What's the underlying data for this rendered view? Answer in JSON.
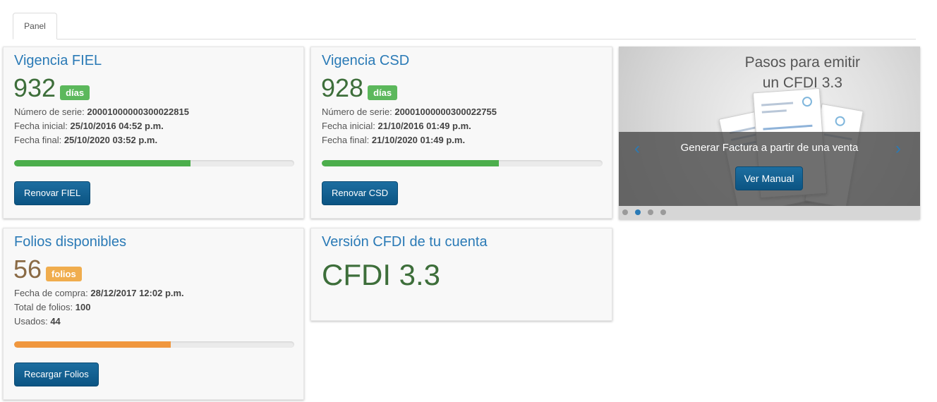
{
  "tabs": [
    {
      "label": "Panel"
    }
  ],
  "fiel": {
    "title": "Vigencia FIEL",
    "days": "932",
    "days_unit": "días",
    "serial_label": "Número de serie:",
    "serial_value": "20001000000300022815",
    "start_label": "Fecha inicial:",
    "start_value": "25/10/2016 04:52 p.m.",
    "end_label": "Fecha final:",
    "end_value": "25/10/2020 03:52 p.m.",
    "progress": 0.63,
    "progress_color": "#4cae4c",
    "button": "Renovar FIEL"
  },
  "csd": {
    "title": "Vigencia CSD",
    "days": "928",
    "days_unit": "días",
    "serial_label": "Número de serie:",
    "serial_value": "20001000000300022755",
    "start_label": "Fecha inicial:",
    "start_value": "21/10/2016 01:49 p.m.",
    "end_label": "Fecha final:",
    "end_value": "21/10/2020 01:49 p.m.",
    "progress": 0.63,
    "progress_color": "#4cae4c",
    "button": "Renovar CSD"
  },
  "folios": {
    "title": "Folios disponibles",
    "count": "56",
    "count_unit": "folios",
    "purchase_label": "Fecha de compra:",
    "purchase_value": "28/12/2017 12:02 p.m.",
    "total_label": "Total de folios:",
    "total_value": "100",
    "used_label": "Usados:",
    "used_value": "44",
    "progress": 0.56,
    "progress_color": "#f0973e",
    "button": "Recargar Folios"
  },
  "cfdi": {
    "title": "Versión CFDI de tu cuenta",
    "version": "CFDI 3.3"
  },
  "carousel": {
    "heading_line1": "Pasos para emitir",
    "heading_line2": "un CFDI 3.3",
    "caption": "Generar Factura a partir de una venta",
    "button": "Ver Manual",
    "prev_icon": "‹",
    "next_icon": "›",
    "slide_count": 4,
    "active_slide": 2
  }
}
